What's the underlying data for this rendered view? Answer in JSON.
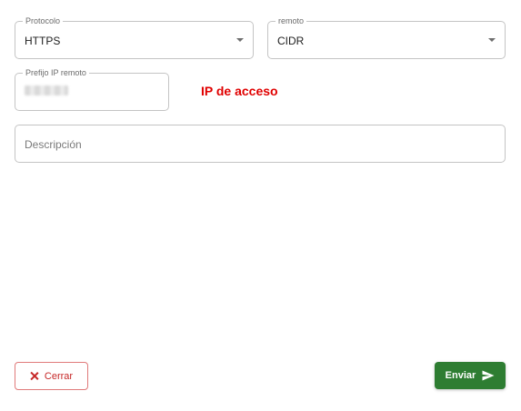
{
  "form": {
    "protocolo": {
      "label": "Protocolo",
      "value": "HTTPS"
    },
    "remoto": {
      "label": "remoto",
      "value": "CIDR"
    },
    "prefijo": {
      "label": "Prefijo IP remoto"
    },
    "descripcion": {
      "placeholder": "Descripción"
    }
  },
  "annotation": {
    "text": "IP de acceso",
    "color": "#e00000"
  },
  "actions": {
    "cerrar_label": "Cerrar",
    "enviar_label": "Enviar"
  },
  "colors": {
    "cancel": "#c62828",
    "submit": "#2e7d32"
  },
  "icons": {
    "close": "close-icon",
    "send": "send-icon",
    "dropdown": "chevron-down-icon"
  }
}
